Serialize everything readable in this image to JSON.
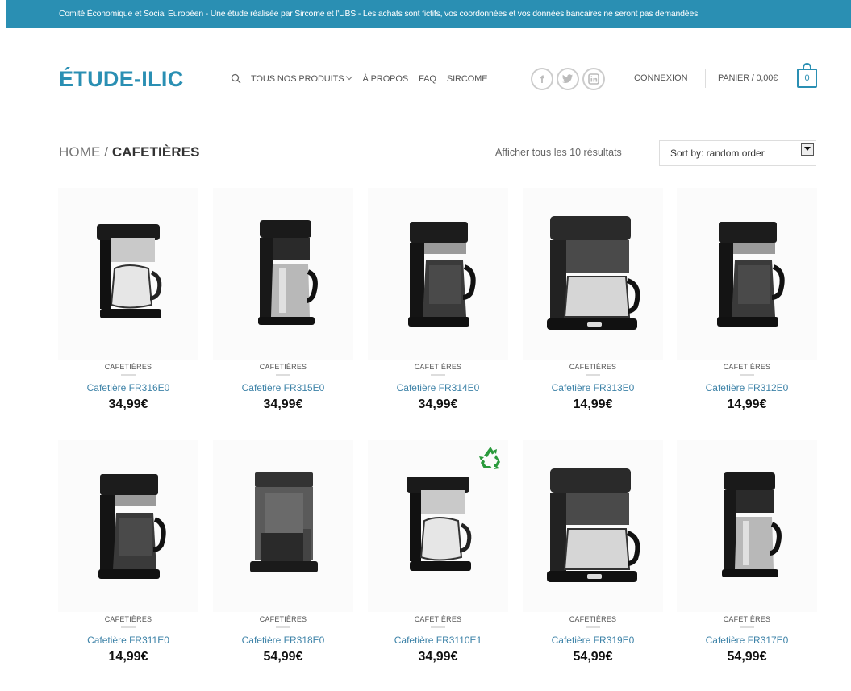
{
  "topbar": {
    "text": "Comité Économique et Social Européen - Une étude réalisée par Sircome et l'UBS - Les achats sont fictifs, vos coordonnées et vos données bancaires ne seront pas demandées"
  },
  "header": {
    "logo": "ÉTUDE-ILIC",
    "nav": [
      "TOUS NOS PRODUITS",
      "À PROPOS",
      "FAQ",
      "SIRCOME"
    ],
    "social": [
      "f",
      "t",
      "in"
    ],
    "login": "CONNEXION",
    "cart_label": "PANIER / 0,00€",
    "cart_count": "0"
  },
  "breadcrumb": {
    "home": "HOME",
    "separator": " / ",
    "current": "CAFETIÈRES"
  },
  "results_text": "Afficher tous les 10 résultats",
  "sort": {
    "selected": "Sort by: random order"
  },
  "colors": {
    "accent": "#2a8fb3",
    "link": "#3e83a8",
    "recycle": "#2a9a3c"
  },
  "products": [
    {
      "category": "CAFETIÈRES",
      "name": "Cafetière FR316E0",
      "price": "34,99€",
      "style": "open"
    },
    {
      "category": "CAFETIÈRES",
      "name": "Cafetière FR315E0",
      "price": "34,99€",
      "style": "steel"
    },
    {
      "category": "CAFETIÈRES",
      "name": "Cafetière FR314E0",
      "price": "34,99€",
      "style": "black"
    },
    {
      "category": "CAFETIÈRES",
      "name": "Cafetière FR313E0",
      "price": "14,99€",
      "style": "wide"
    },
    {
      "category": "CAFETIÈRES",
      "name": "Cafetière FR312E0",
      "price": "14,99€",
      "style": "black"
    },
    {
      "category": "CAFETIÈRES",
      "name": "Cafetière FR311E0",
      "price": "14,99€",
      "style": "black"
    },
    {
      "category": "CAFETIÈRES",
      "name": "Cafetière FR318E0",
      "price": "54,99€",
      "style": "tall"
    },
    {
      "category": "CAFETIÈRES",
      "name": "Cafetière FR3110E1",
      "price": "34,99€",
      "style": "open",
      "badge": "recycle-icon"
    },
    {
      "category": "CAFETIÈRES",
      "name": "Cafetière FR319E0",
      "price": "54,99€",
      "style": "wide"
    },
    {
      "category": "CAFETIÈRES",
      "name": "Cafetière FR317E0",
      "price": "54,99€",
      "style": "steel"
    }
  ]
}
